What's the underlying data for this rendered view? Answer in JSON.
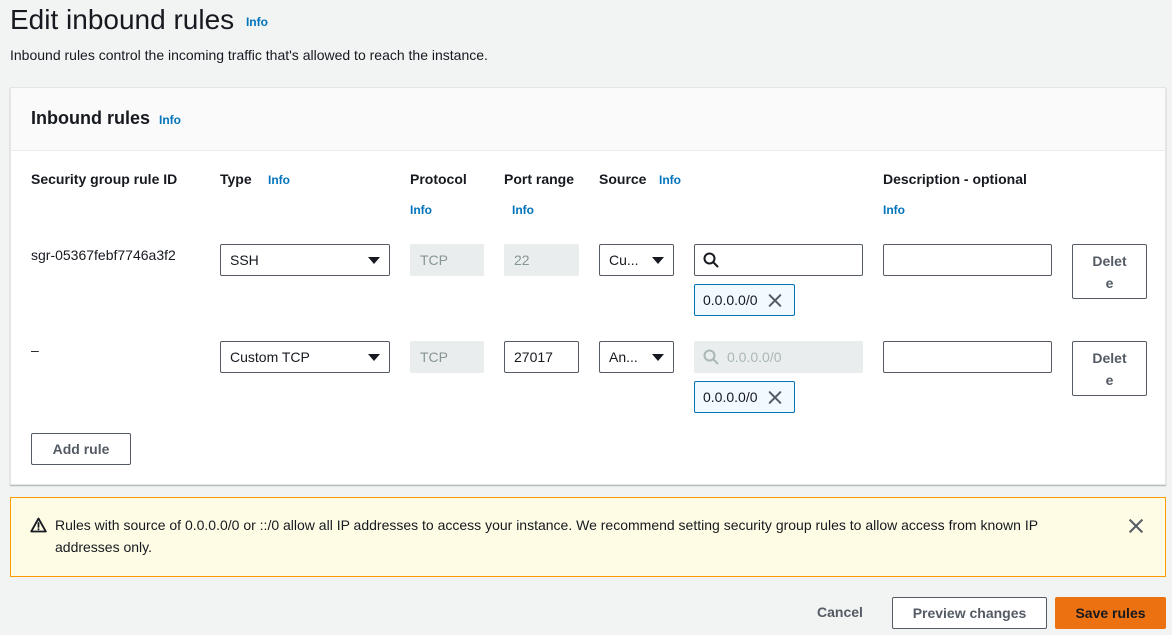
{
  "page": {
    "title": "Edit inbound rules",
    "info": "Info",
    "description": "Inbound rules control the incoming traffic that's allowed to reach the instance."
  },
  "panel": {
    "title": "Inbound rules",
    "info": "Info",
    "columns": {
      "rule_id": "Security group rule ID",
      "type": "Type",
      "protocol": "Protocol",
      "port_range": "Port range",
      "source": "Source",
      "description": "Description - optional",
      "info": "Info"
    },
    "rules": [
      {
        "rule_id": "sgr-05367febf7746a3f2",
        "type": "SSH",
        "protocol": "TCP",
        "port_range": "22",
        "source_type": "Cu...",
        "source_search_value": "",
        "source_search_placeholder": "",
        "source_token": "0.0.0.0/0",
        "description": "",
        "delete_label": "Delete"
      },
      {
        "rule_id": "–",
        "type": "Custom TCP",
        "protocol": "TCP",
        "port_range": "27017",
        "source_type": "An...",
        "source_search_value": "",
        "source_search_placeholder": "0.0.0.0/0",
        "source_token": "0.0.0.0/0",
        "description": "",
        "delete_label": "Delete"
      }
    ],
    "add_rule_label": "Add rule"
  },
  "warning": {
    "text": "Rules with source of 0.0.0.0/0 or ::/0 allow all IP addresses to access your instance. We recommend setting security group rules to allow access from known IP addresses only."
  },
  "footer": {
    "cancel_label": "Cancel",
    "preview_label": "Preview changes",
    "save_label": "Save rules"
  },
  "colors": {
    "link": "#0073bb",
    "primary": "#ec7211",
    "warning_bg": "#fffce5",
    "warning_border": "#ff9900",
    "token_bg": "#f1faff"
  }
}
